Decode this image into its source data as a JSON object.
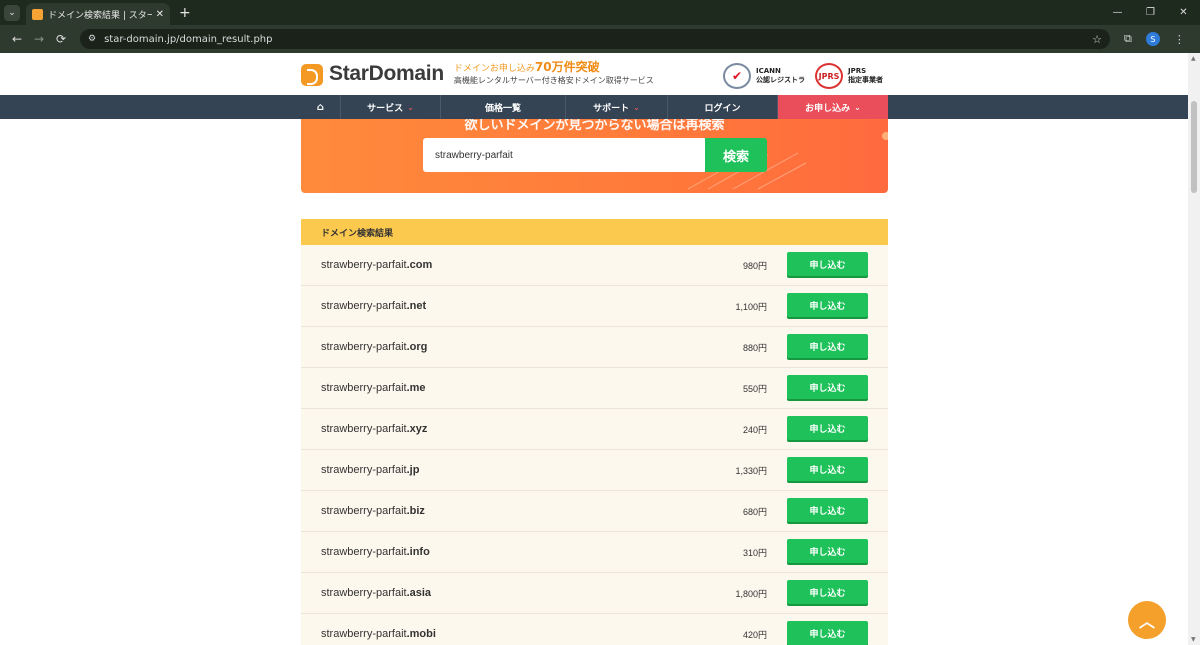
{
  "browser": {
    "tab_title": "ドメイン検索結果 | スタードメイン -",
    "tab_close": "✕",
    "tab_switch": "⌄",
    "new_tab": "+",
    "url": "star-domain.jp/domain_result.php",
    "back": "←",
    "forward": "→",
    "reload": "⟳",
    "site_info": "⚙",
    "bookmark_star": "☆",
    "extensions": "⧉",
    "profile_initial": "S",
    "menu": "⋮",
    "minimize": "—",
    "maximize": "❐",
    "close": "✕"
  },
  "header": {
    "logo": "StarDomain",
    "tagline_prefix": "ドメインお申し込み",
    "tagline_highlight": "70万件突破",
    "tagline_sub": "高機能レンタルサーバー付き格安ドメイン取得サービス",
    "icann_line1": "ICANN",
    "icann_line2": "公認レジストラ",
    "jprs_seal": "JPRS",
    "jprs_line1": "JPRS",
    "jprs_line2": "指定事業者"
  },
  "nav": {
    "home_icon": "⌂",
    "services": "サービス",
    "pricing": "価格一覧",
    "support": "サポート",
    "login": "ログイン",
    "apply": "お申し込み",
    "chevron": "⌄"
  },
  "search": {
    "headline": "欲しいドメインが見つからない場合は再検索",
    "value": "strawberry-parfait",
    "button": "検索"
  },
  "results": {
    "title": "ドメイン検索結果",
    "apply_label": "申し込む",
    "rows": [
      {
        "base": "strawberry-parfait",
        "tld": ".com",
        "price": "980円"
      },
      {
        "base": "strawberry-parfait",
        "tld": ".net",
        "price": "1,100円"
      },
      {
        "base": "strawberry-parfait",
        "tld": ".org",
        "price": "880円"
      },
      {
        "base": "strawberry-parfait",
        "tld": ".me",
        "price": "550円"
      },
      {
        "base": "strawberry-parfait",
        "tld": ".xyz",
        "price": "240円"
      },
      {
        "base": "strawberry-parfait",
        "tld": ".jp",
        "price": "1,330円"
      },
      {
        "base": "strawberry-parfait",
        "tld": ".biz",
        "price": "680円"
      },
      {
        "base": "strawberry-parfait",
        "tld": ".info",
        "price": "310円"
      },
      {
        "base": "strawberry-parfait",
        "tld": ".asia",
        "price": "1,800円"
      },
      {
        "base": "strawberry-parfait",
        "tld": ".mobi",
        "price": "420円"
      }
    ]
  },
  "to_top_icon": "︿"
}
